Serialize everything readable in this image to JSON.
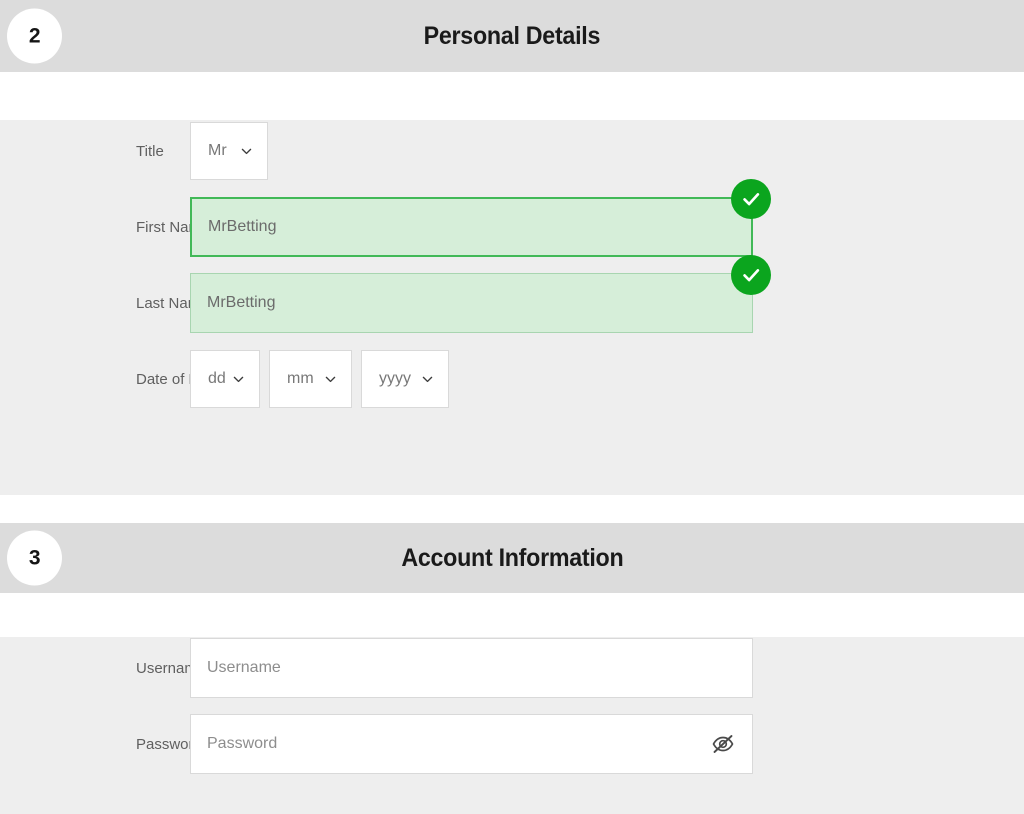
{
  "theme": {
    "header_band": "#dcdcdc",
    "body_bg": "#eeeeee",
    "accent_green": "#0ba51e",
    "valid_field_bg": "#d6eed9",
    "valid_border": "#41b957",
    "label_color": "#5f5f5f",
    "placeholder_color": "#8d8d8d"
  },
  "sections": [
    {
      "step": "2",
      "title": "Personal Details",
      "fields": {
        "title": {
          "label": "Title",
          "value": "Mr",
          "chevron_icon": "chevron-down-icon"
        },
        "first_name": {
          "label": "First Name",
          "value": "MrBetting",
          "state": "valid-focus",
          "badge_icon": "check-circle-icon"
        },
        "last_name": {
          "label": "Last Name",
          "value": "MrBetting",
          "state": "valid",
          "badge_icon": "check-circle-icon"
        },
        "date_of_birth": {
          "label": "Date of Birth",
          "day": "dd",
          "month": "mm",
          "year": "yyyy"
        }
      }
    },
    {
      "step": "3",
      "title": "Account Information",
      "fields": {
        "username": {
          "label": "Username",
          "value": "",
          "placeholder": "Username"
        },
        "password": {
          "label": "Password",
          "value": "",
          "placeholder": "Password",
          "toggle_icon": "eye-slash-icon"
        }
      }
    }
  ]
}
